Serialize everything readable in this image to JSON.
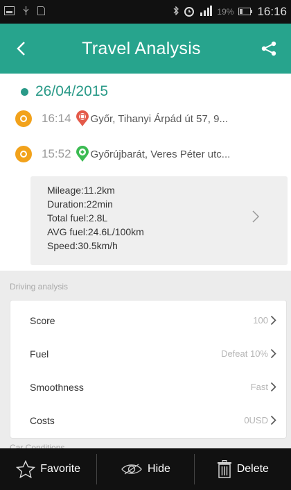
{
  "status_bar": {
    "battery_percent": "19%",
    "time": "16:16"
  },
  "header": {
    "title": "Travel Analysis",
    "icons": [
      "back-chevron-icon",
      "share-icon"
    ],
    "color": "#27a48d"
  },
  "trip": {
    "date": "26/04/2015",
    "end": {
      "time": "16:14",
      "address": "Győr, Tihanyi Árpád út 57, 9..."
    },
    "start": {
      "time": "15:52",
      "address": "Győrújbarát, Veres Péter utc..."
    }
  },
  "summary": {
    "mileage": "Mileage:11.2km",
    "duration": "Duration:22min",
    "total_fuel": "Total fuel:2.8L",
    "avg_fuel": "AVG fuel:24.6L/100km",
    "speed": "Speed:30.5km/h"
  },
  "driving_analysis": {
    "label": "Driving analysis",
    "rows": [
      {
        "label": "Score",
        "value": "100"
      },
      {
        "label": "Fuel",
        "value": "Defeat 10%"
      },
      {
        "label": "Smoothness",
        "value": "Fast"
      },
      {
        "label": "Costs",
        "value": "0USD"
      }
    ]
  },
  "car_conditions": {
    "label": "Car Conditions"
  },
  "bottom_bar": {
    "favorite": "Favorite",
    "hide": "Hide",
    "delete": "Delete"
  }
}
